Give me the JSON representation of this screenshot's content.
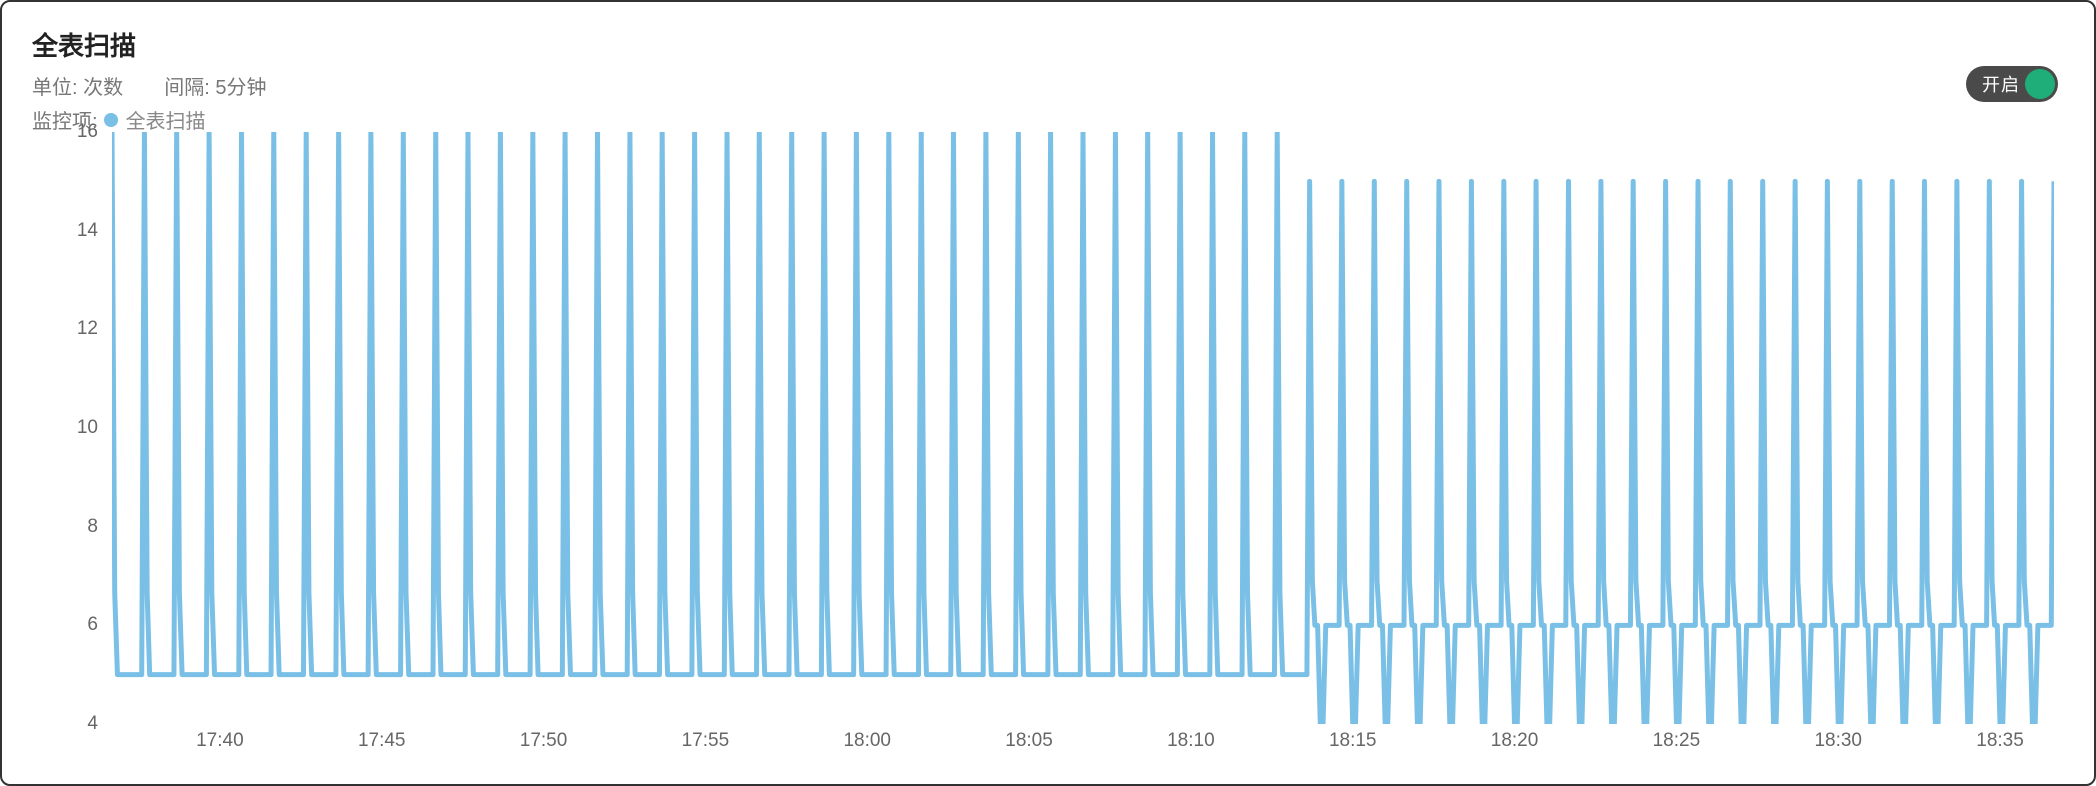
{
  "header": {
    "title": "全表扫描",
    "unit_label": "单位:",
    "unit_value": "次数",
    "interval_label": "间隔:",
    "interval_value": "5分钟",
    "monitor_label": "监控项:",
    "legend_name": "全表扫描"
  },
  "toggle": {
    "label": "开启",
    "on": true,
    "on_color": "#1fae7a"
  },
  "colors": {
    "line": "#7ac0e6",
    "legend_dot": "#7ac0e6"
  },
  "chart_data": {
    "type": "line",
    "title": "全表扫描",
    "xlabel": "",
    "ylabel": "",
    "ylim": [
      4,
      16
    ],
    "y_ticks": [
      4,
      6,
      8,
      10,
      12,
      14,
      16
    ],
    "x_tick_labels": [
      "17:40",
      "17:45",
      "17:50",
      "17:55",
      "18:00",
      "18:05",
      "18:10",
      "18:15",
      "18:20",
      "18:25",
      "18:30",
      "18:35"
    ],
    "x_tick_positions": [
      40,
      100,
      160,
      220,
      280,
      340,
      400,
      460,
      520,
      580,
      640,
      700
    ],
    "xlim": [
      0,
      720
    ],
    "series": [
      {
        "name": "全表扫描",
        "color": "#7ac0e6",
        "baseline_early": 5,
        "baseline_late": 6,
        "peak_early": 16,
        "peak_late": 15,
        "mode_change_at": 444,
        "trough_late": 4,
        "values_description": "Before ~18:13 the series sits at a baseline of 5 with sharp periodic spikes reaching 16 (full height, clipped at top). After ~18:13 the baseline becomes 6, spikes reach 15, and each cycle also dips to a trough of 4 between spikes.",
        "representative_points_early": [
          5,
          5,
          16,
          5,
          5,
          5,
          5,
          5,
          5,
          5,
          5,
          5,
          16,
          5,
          5
        ],
        "representative_points_late": [
          6,
          6,
          15,
          6,
          4,
          6,
          6,
          6,
          6,
          15,
          6,
          4,
          6,
          6
        ]
      }
    ]
  }
}
